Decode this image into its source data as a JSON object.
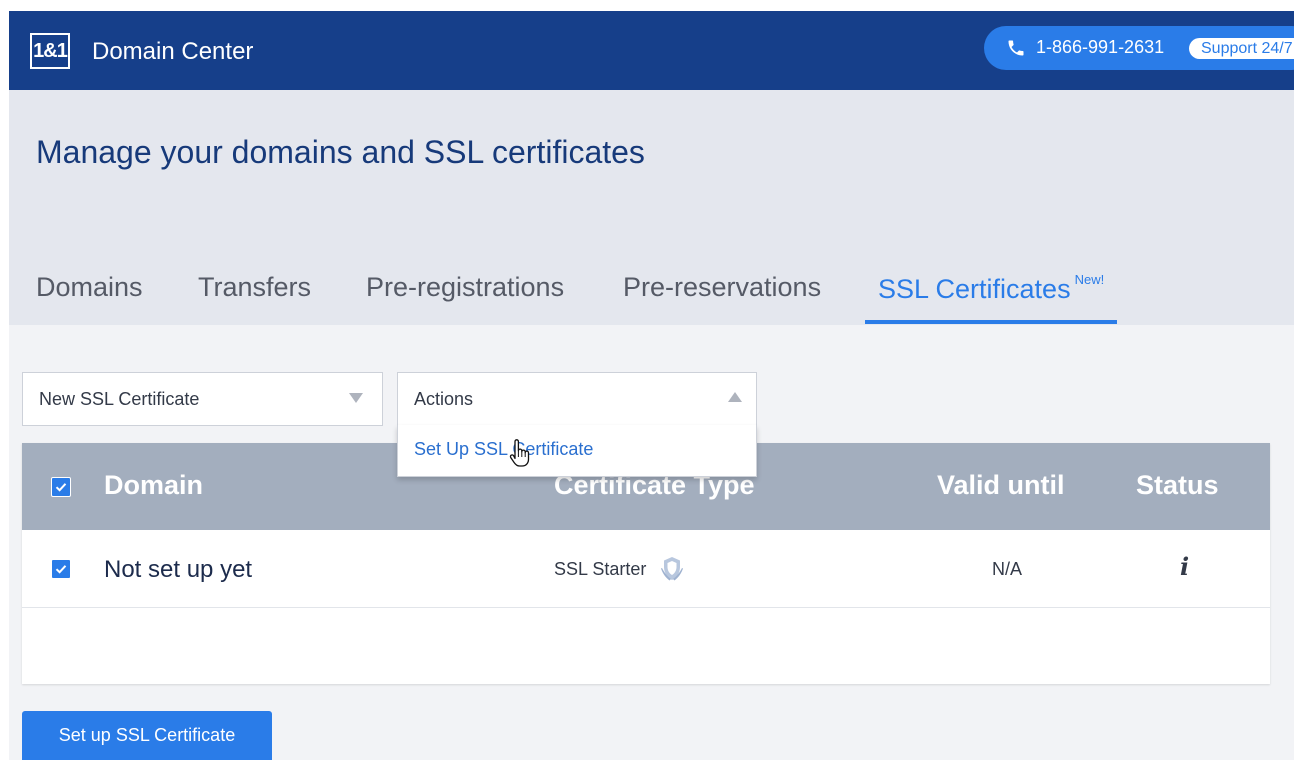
{
  "header": {
    "logo_text": "1&1",
    "app_title": "Domain Center",
    "phone": "1-866-991-2631",
    "support_label": "Support 24/7"
  },
  "page": {
    "title": "Manage your domains and SSL certificates"
  },
  "tabs": [
    {
      "label": "Domains",
      "active": false
    },
    {
      "label": "Transfers",
      "active": false
    },
    {
      "label": "Pre-registrations",
      "active": false
    },
    {
      "label": "Pre-reservations",
      "active": false
    },
    {
      "label": "SSL Certificates",
      "badge": "New!",
      "active": true
    }
  ],
  "toolbar": {
    "product_select_value": "New SSL Certificate",
    "actions_select_value": "Actions",
    "actions_menu": [
      {
        "label": "Set Up SSL Certificate"
      }
    ]
  },
  "table": {
    "columns": [
      "Domain",
      "Certificate Type",
      "Valid until",
      "Status"
    ],
    "rows": [
      {
        "checked": true,
        "domain": "Not set up yet",
        "certificate_type": "SSL Starter",
        "valid_until": "N/A",
        "status_icon": "info-icon"
      }
    ],
    "header_checked": true
  },
  "primary_action": {
    "label": "Set up SSL Certificate"
  },
  "icons": {
    "phone": "phone-icon",
    "shield": "shield-icon",
    "info": "info-icon",
    "cursor": "hand-pointer-icon"
  },
  "colors": {
    "brand_dark": "#163f8a",
    "accent": "#2a7ce8",
    "table_header": "#a3aebe",
    "subheader_bg": "#e4e7ee"
  }
}
